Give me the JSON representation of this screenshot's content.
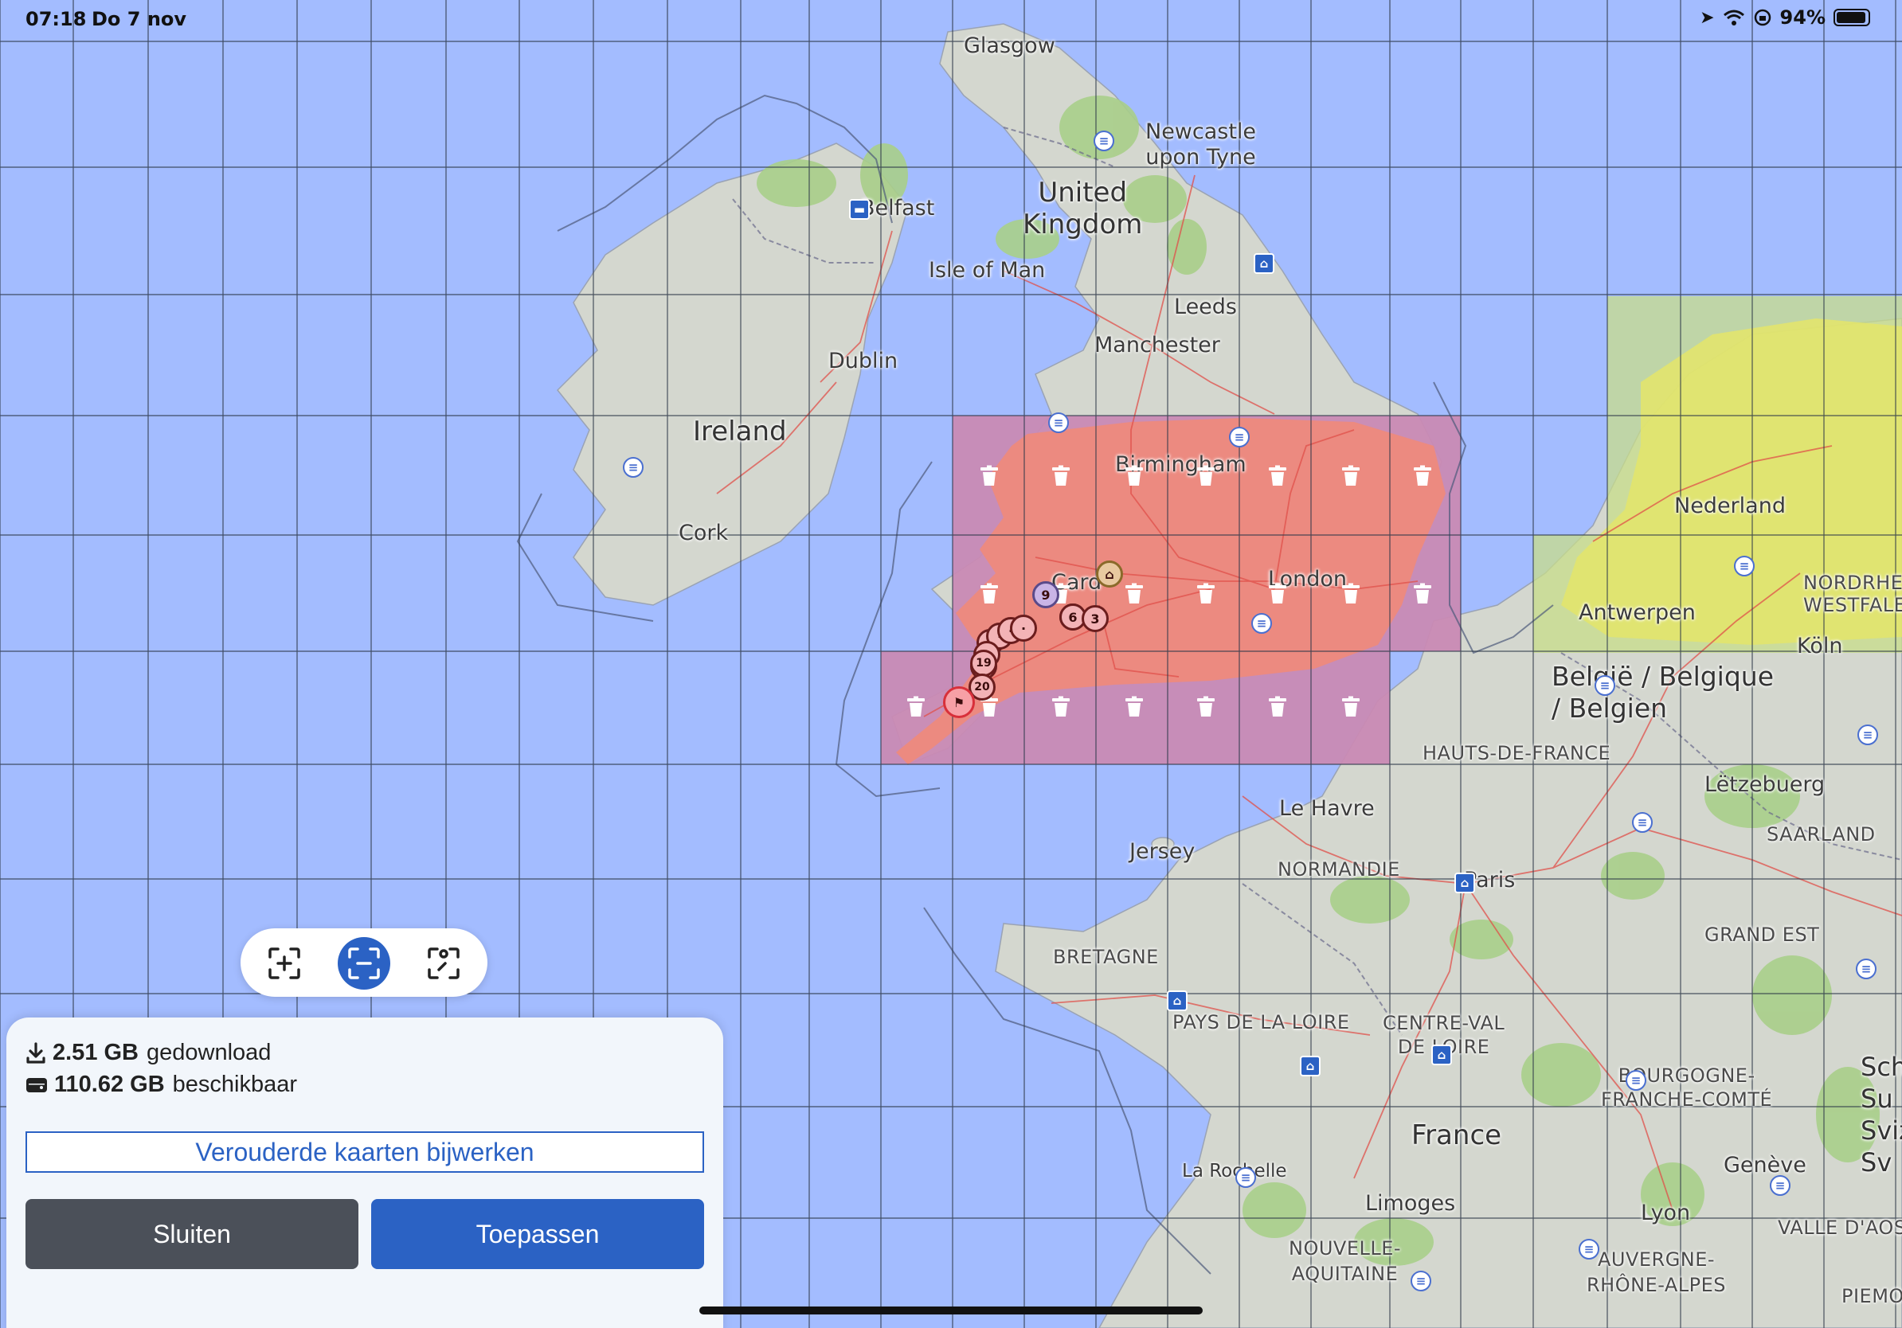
{
  "status_bar": {
    "time": "07:18",
    "date": "Do 7 nov",
    "battery": "94%",
    "icons": [
      "location-arrow-icon",
      "wifi-icon",
      "lock-rotation-icon",
      "battery-icon"
    ]
  },
  "map": {
    "colors": {
      "sea": "#a3bcff",
      "land": "#d4d7cf",
      "forest": "#a9cf8a",
      "selected_region": "#c98ab4",
      "selected_land": "#ef8a7a",
      "downloaded_region": "#c8de8a",
      "downloaded_land": "#e4e56a",
      "grid": "#2f3a4a",
      "roads": "#e0504a"
    },
    "labels": {
      "glasgow": "Glasgow",
      "newcastle": "Newcastle\nupon Tyne",
      "united_kingdom": "United\nKingdom",
      "belfast": "Belfast",
      "isle_of_man": "Isle of Man",
      "leeds": "Leeds",
      "manchester": "Manchester",
      "dublin": "Dublin",
      "ireland": "Ireland",
      "cork": "Cork",
      "birmingham": "Birmingham",
      "cardiff": "Card",
      "london": "London",
      "nederland": "Nederland",
      "antwerpen": "Antwerpen",
      "nordrhein": "NORDRHEI\nWESTFALE",
      "koln": "Köln",
      "belgique": "België / Belgique\n/ Belgien",
      "hauts_de_france": "HAUTS-DE-FRANCE",
      "letzebuerg": "Lëtzebuerg",
      "saarland": "SAARLAND",
      "le_havre": "Le Havre",
      "jersey": "Jersey",
      "normandie": "NORMANDIE",
      "paris": "Paris",
      "grand_est": "GRAND EST",
      "bretagne": "BRETAGNE",
      "pays_de_la_loire": "PAYS DE LA LOIRE",
      "centre_val_de_loire": "CENTRE-VAL\nDE LOIRE",
      "bourgogne": "BOURGOGNE-\nFRANCHE-COMTÉ",
      "france": "France",
      "la_rochelle": "La Rochelle",
      "limoges": "Limoges",
      "geneve": "Genève",
      "lyon": "Lyon",
      "valle_daosta": "VALLE D'AOS",
      "nouvelle_aquitaine": "NOUVELLE-\nAQUITAINE",
      "auvergne": "AUVERGNE-\nRHÔNE-ALPES",
      "piemonte": "PIEMO",
      "schweiz": "Sch\nSu\nSviz\nSv"
    },
    "route_markers": [
      "9",
      "6",
      "3",
      "19",
      "20"
    ],
    "marker_icons": {
      "trash": "trash-icon",
      "poi": "menu-list-icon",
      "museum": "museum-icon",
      "home": "home-icon",
      "start": "flag-icon",
      "hotel": "bed-icon"
    }
  },
  "zoom_control": {
    "buttons": [
      "zoom-in-area-icon",
      "zoom-out-area-icon",
      "select-area-icon"
    ],
    "active_index": 1
  },
  "panel": {
    "downloaded_value": "2.51 GB",
    "downloaded_label": "gedownload",
    "available_value": "110.62 GB",
    "available_label": "beschikbaar",
    "update_button": "Verouderde kaarten bijwerken",
    "close_button": "Sluiten",
    "apply_button": "Toepassen"
  }
}
